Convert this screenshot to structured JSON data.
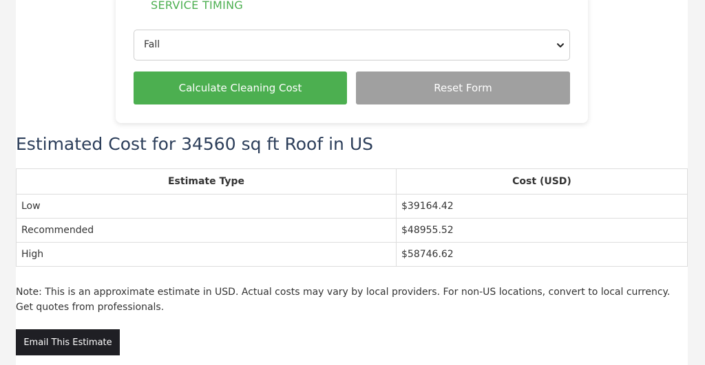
{
  "form": {
    "section_title": "SERVICE TIMING",
    "service_timing": {
      "selected": "Fall",
      "icon": "chevron-down-icon"
    },
    "calculate_label": "Calculate Cleaning Cost",
    "reset_label": "Reset Form"
  },
  "results": {
    "title": "Estimated Cost for 34560 sq ft Roof in US",
    "table": {
      "headers": [
        "Estimate Type",
        "Cost (USD)"
      ],
      "rows": [
        {
          "type": "Low",
          "cost": "$39164.42"
        },
        {
          "type": "Recommended",
          "cost": "$48955.52"
        },
        {
          "type": "High",
          "cost": "$58746.62"
        }
      ]
    },
    "note": "Note: This is an approximate estimate in USD. Actual costs may vary by local providers. For non-US locations, convert to local currency. Get quotes from professionals.",
    "email_label": "Email This Estimate"
  },
  "colors": {
    "accent_green": "#4caf50",
    "reset_gray": "#a0a0a0",
    "title_navy": "#2c3e5a",
    "email_dark": "#1f1f24"
  }
}
